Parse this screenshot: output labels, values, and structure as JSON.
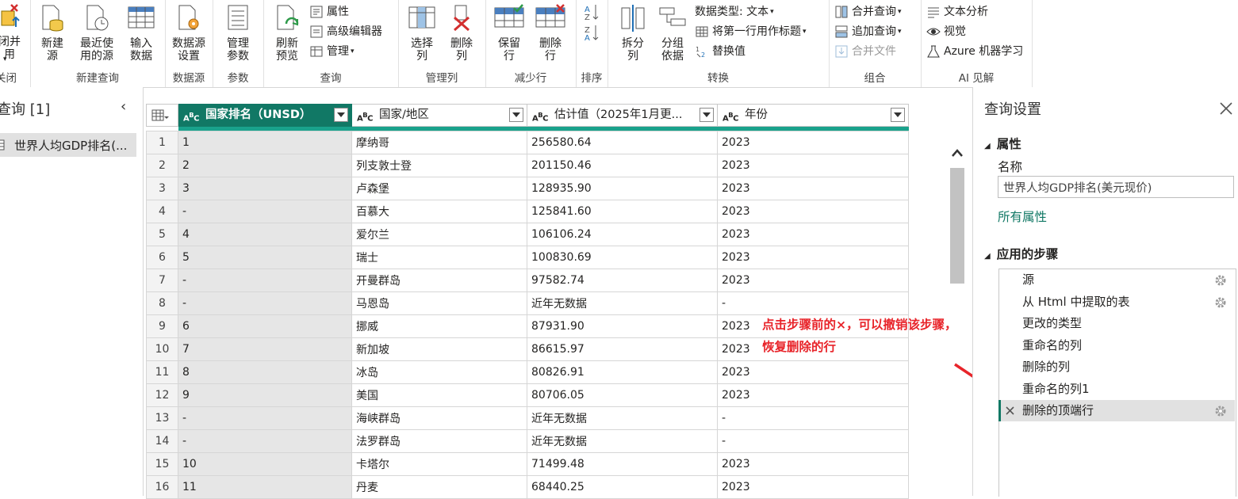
{
  "ribbon": {
    "groups": {
      "close": "关闭",
      "new_query": "新建查询",
      "data_source": "数据源",
      "params": "参数",
      "query": "查询",
      "manage_cols": "管理列",
      "reduce_rows": "减少行",
      "sort": "排序",
      "transform": "转换",
      "combine": "组合",
      "ai": "AI 见解"
    },
    "buttons": {
      "close_apply": "闭并\n用",
      "new_source": "新建\n源",
      "recent_source": "最近使\n用的源",
      "enter_data": "输入\n数据",
      "ds_settings": "数据源\n设置",
      "manage_params": "管理\n参数",
      "refresh_preview": "刷新\n预览",
      "choose_cols": "选择\n列",
      "remove_cols": "删除\n列",
      "keep_rows": "保留\n行",
      "remove_rows": "删除\n行",
      "split_col": "拆分\n列",
      "group_by": "分组\n依据"
    },
    "small": {
      "properties": "属性",
      "advanced_editor": "高级编辑器",
      "manage": "管理",
      "data_type": "数据类型: 文本",
      "first_row_header": "将第一行用作标题",
      "replace_values": "替换值",
      "merge_queries": "合并查询",
      "append_queries": "追加查询",
      "combine_files": "合并文件",
      "text_analytics": "文本分析",
      "vision": "视觉",
      "azure_ml": "Azure 机器学习"
    }
  },
  "left_pane": {
    "title": "查询 [1]",
    "query_item": "世界人均GDP排名(..."
  },
  "table": {
    "columns": [
      "国家排名（UNSD）",
      "国家/地区",
      "估计值（2025年1月更...",
      "年份"
    ],
    "rows": [
      [
        "1",
        "1",
        "摩纳哥",
        "256580.64",
        "2023"
      ],
      [
        "2",
        "2",
        "列支敦士登",
        "201150.46",
        "2023"
      ],
      [
        "3",
        "3",
        "卢森堡",
        "128935.90",
        "2023"
      ],
      [
        "4",
        "-",
        "百慕大",
        "125841.60",
        "2023"
      ],
      [
        "5",
        "4",
        "爱尔兰",
        "106106.24",
        "2023"
      ],
      [
        "6",
        "5",
        "瑞士",
        "100830.69",
        "2023"
      ],
      [
        "7",
        "-",
        "开曼群岛",
        "97582.74",
        "2023"
      ],
      [
        "8",
        "-",
        "马恩岛",
        "近年无数据",
        "-"
      ],
      [
        "9",
        "6",
        "挪威",
        "87931.90",
        "2023"
      ],
      [
        "10",
        "7",
        "新加坡",
        "86615.97",
        "2023"
      ],
      [
        "11",
        "8",
        "冰岛",
        "80826.91",
        "2023"
      ],
      [
        "12",
        "9",
        "美国",
        "80706.05",
        "2023"
      ],
      [
        "13",
        "-",
        "海峡群岛",
        "近年无数据",
        "-"
      ],
      [
        "14",
        "-",
        "法罗群岛",
        "近年无数据",
        "-"
      ],
      [
        "15",
        "10",
        "卡塔尔",
        "71499.48",
        "2023"
      ],
      [
        "16",
        "11",
        "丹麦",
        "68440.25",
        "2023"
      ]
    ]
  },
  "annotation": {
    "line1": "点击步骤前的×，可以撤销该步骤，",
    "line2": "恢复删除的行",
    "color": "#e8242a"
  },
  "right_pane": {
    "title": "查询设置",
    "properties_header": "属性",
    "name_label": "名称",
    "name_value": "世界人均GDP排名(美元现价)",
    "all_properties": "所有属性",
    "applied_steps_header": "应用的步骤",
    "steps": [
      "源",
      "从 Html 中提取的表",
      "更改的类型",
      "重命名的列",
      "删除的列",
      "重命名的列1",
      "删除的顶端行"
    ]
  },
  "colors": {
    "accent": "#117865",
    "query_bar": "#1aa28c",
    "link": "#117865"
  }
}
